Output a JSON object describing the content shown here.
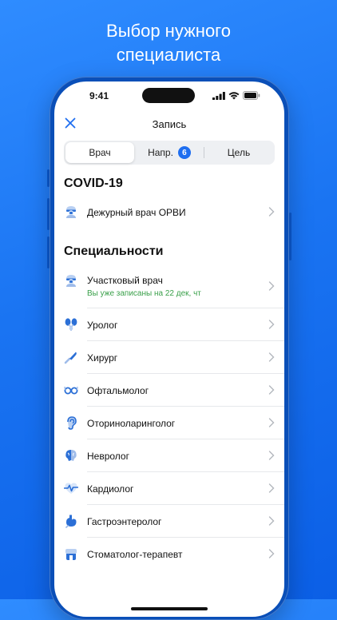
{
  "headline": {
    "line1": "Выбор нужного",
    "line2": "специалиста"
  },
  "status": {
    "time": "9:41"
  },
  "nav": {
    "title": "Запись"
  },
  "segments": [
    {
      "label": "Врач",
      "active": true
    },
    {
      "label": "Напр.",
      "badge": "6"
    },
    {
      "label": "Цель"
    }
  ],
  "covid": {
    "title": "COVID-19",
    "items": [
      {
        "label": "Дежурный врач ОРВИ",
        "icon": "doctor-icon"
      }
    ]
  },
  "specialties": {
    "title": "Специальности",
    "items": [
      {
        "label": "Участковый врач",
        "note": "Вы уже записаны на 22 дек, чт",
        "icon": "doctor-icon"
      },
      {
        "label": "Уролог",
        "icon": "urology-icon"
      },
      {
        "label": "Хирург",
        "icon": "scalpel-icon"
      },
      {
        "label": "Офтальмолог",
        "icon": "glasses-icon"
      },
      {
        "label": "Оториноларинголог",
        "icon": "ear-icon"
      },
      {
        "label": "Невролог",
        "icon": "brain-icon"
      },
      {
        "label": "Кардиолог",
        "icon": "heartbeat-icon"
      },
      {
        "label": "Гастроэнтеролог",
        "icon": "stomach-icon"
      },
      {
        "label": "Стоматолог-терапевт",
        "icon": "tooth-icon"
      }
    ]
  },
  "colors": {
    "accent": "#1e6ef0",
    "note_green": "#3aa04a",
    "background_blue": "#1a74f2"
  }
}
